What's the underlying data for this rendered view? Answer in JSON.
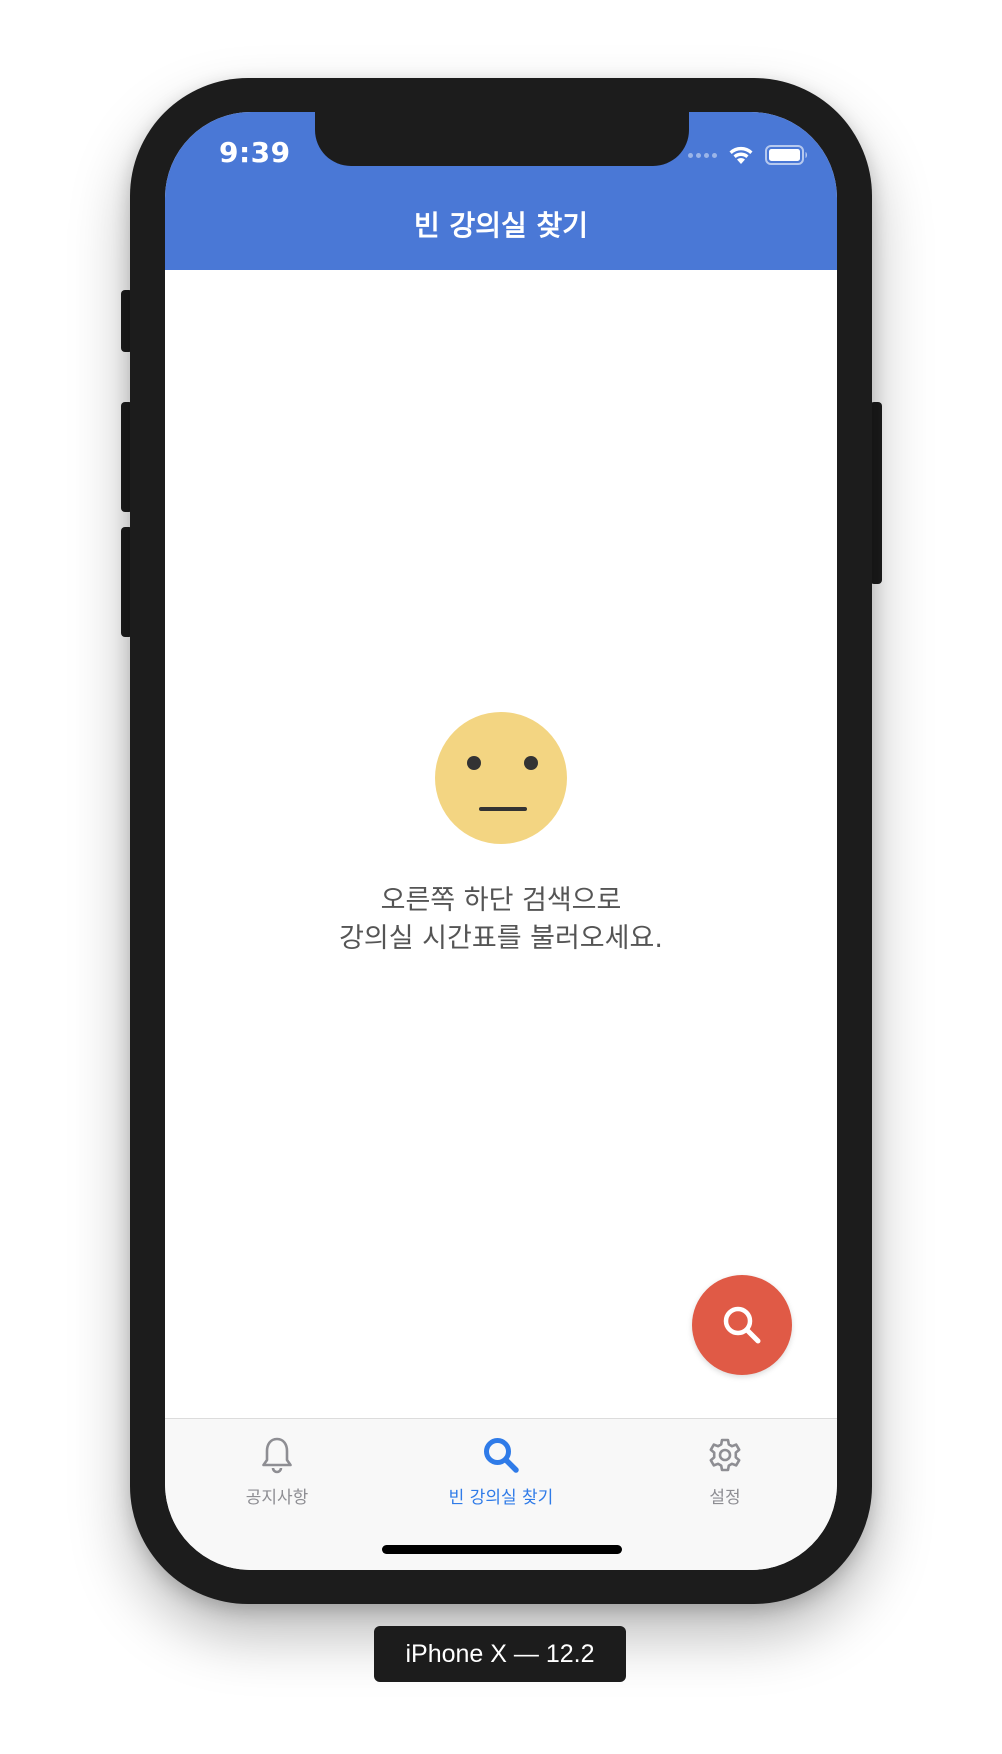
{
  "status_bar": {
    "time": "9:39"
  },
  "nav": {
    "title": "빈 강의실 찾기"
  },
  "empty_state": {
    "icon": "neutral-face-emoji",
    "line1": "오른쪽 하단 검색으로",
    "line2": "강의실 시간표를 불러오세요."
  },
  "fab": {
    "icon": "search-icon",
    "color": "#e05a46"
  },
  "tabbar": {
    "tabs": [
      {
        "label": "공지사항",
        "icon": "bell-icon",
        "active": false
      },
      {
        "label": "빈 강의실 찾기",
        "icon": "search-icon",
        "active": true
      },
      {
        "label": "설정",
        "icon": "gear-icon",
        "active": false
      }
    ]
  },
  "device_label": "iPhone X — 12.2",
  "colors": {
    "header": "#4a78d6",
    "active_tab": "#2f7be8",
    "inactive_tab": "#8e8e93",
    "emoji": "#f3d582"
  }
}
